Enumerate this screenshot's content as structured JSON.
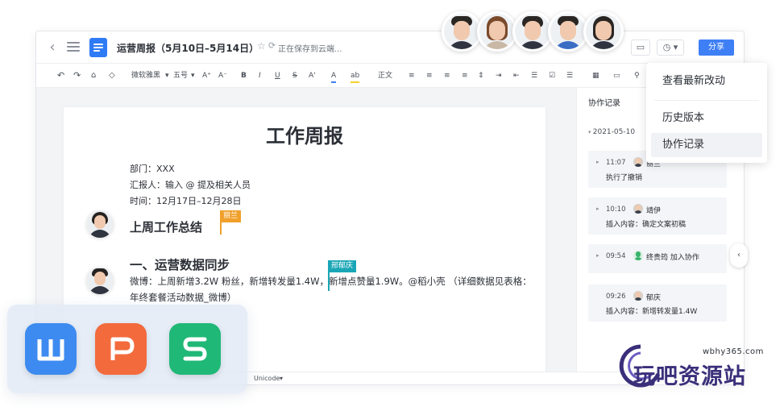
{
  "titlebar": {
    "doc_title": "运营周报（5月10日–5月14日）",
    "save_status": "正在保存到云端...",
    "share_label": "分享"
  },
  "toolbar": {
    "font_name": "微软雅黑",
    "font_size": "五号",
    "paragraph_style": "正文"
  },
  "document": {
    "title": "工作周报",
    "department": "部门：XXX",
    "reporter": "汇报人：输入 @ 提及相关人员",
    "time": "时间：12月17日–12月28日",
    "section1": "上周工作总结",
    "section2": "一、运营数据同步",
    "paragraph": "微博：上周新增3.2W 粉丝，新增转发量1.4W，新增点赞量1.9W。@稻小壳 （详细数据见表格：年终套餐活动数据_微博）",
    "cursor1_name": "丽兰",
    "cursor2_name": "邢郁庆",
    "accent_orange": "#f0a02b",
    "accent_teal": "#1aa6b6"
  },
  "status_bar": {
    "encoding": "Unicode"
  },
  "side_panel": {
    "title": "协作记录",
    "date": "2021-05-10",
    "records": [
      {
        "time": "11:07",
        "name": "丽兰",
        "action": "执行了撤销"
      },
      {
        "time": "10:10",
        "name": "靖伊",
        "action": "插入内容：确定文案初稿"
      },
      {
        "time": "09:54",
        "name": "终贵筠 加入协作",
        "action": ""
      },
      {
        "time": "09:26",
        "name": "郁庆",
        "action": "插入内容：新增转发量1.4W"
      }
    ]
  },
  "dropdown": {
    "items": [
      "查看最新改动",
      "历史版本",
      "协作记录"
    ]
  },
  "apps": {
    "writer_color": "#3d8bf0",
    "presentation_color": "#f36a3c",
    "spreadsheet_color": "#20b877"
  },
  "watermark": {
    "url": "wbhy365.com",
    "text": "玩吧资源站"
  }
}
